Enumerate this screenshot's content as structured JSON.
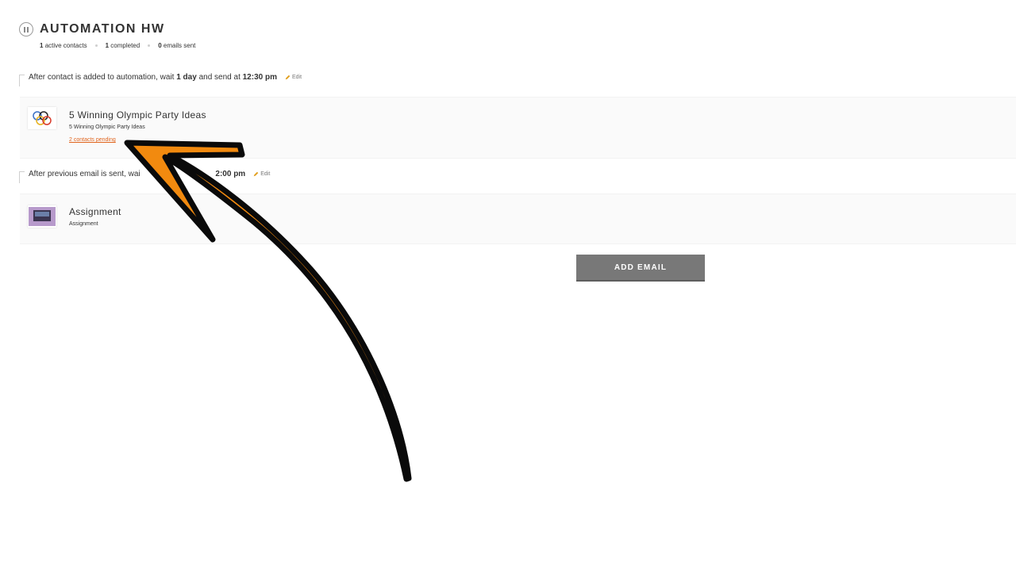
{
  "header": {
    "title": "AUTOMATION HW",
    "stats": {
      "active_count": "1",
      "active_label": "active contacts",
      "completed_count": "1",
      "completed_label": "completed",
      "sent_count": "0",
      "sent_label": "emails sent"
    }
  },
  "steps": [
    {
      "delay": {
        "prefix": "After contact is added to automation, wait",
        "wait": "1 day",
        "middle": "and send at",
        "time": "12:30 pm",
        "edit_label": "Edit"
      },
      "email": {
        "title": "5 Winning Olympic Party Ideas",
        "subject": "5 Winning Olympic Party Ideas",
        "pending": "2 contacts pending"
      }
    },
    {
      "delay": {
        "prefix": "After previous email is sent, wai",
        "time": "2:00 pm",
        "edit_label": "Edit"
      },
      "email": {
        "title": "Assignment",
        "subject": "Assignment"
      }
    }
  ],
  "add_email_label": "ADD EMAIL",
  "colors": {
    "accent_orange": "#f28a0f",
    "pending_link": "#e0641d",
    "button_gray": "#787878"
  }
}
